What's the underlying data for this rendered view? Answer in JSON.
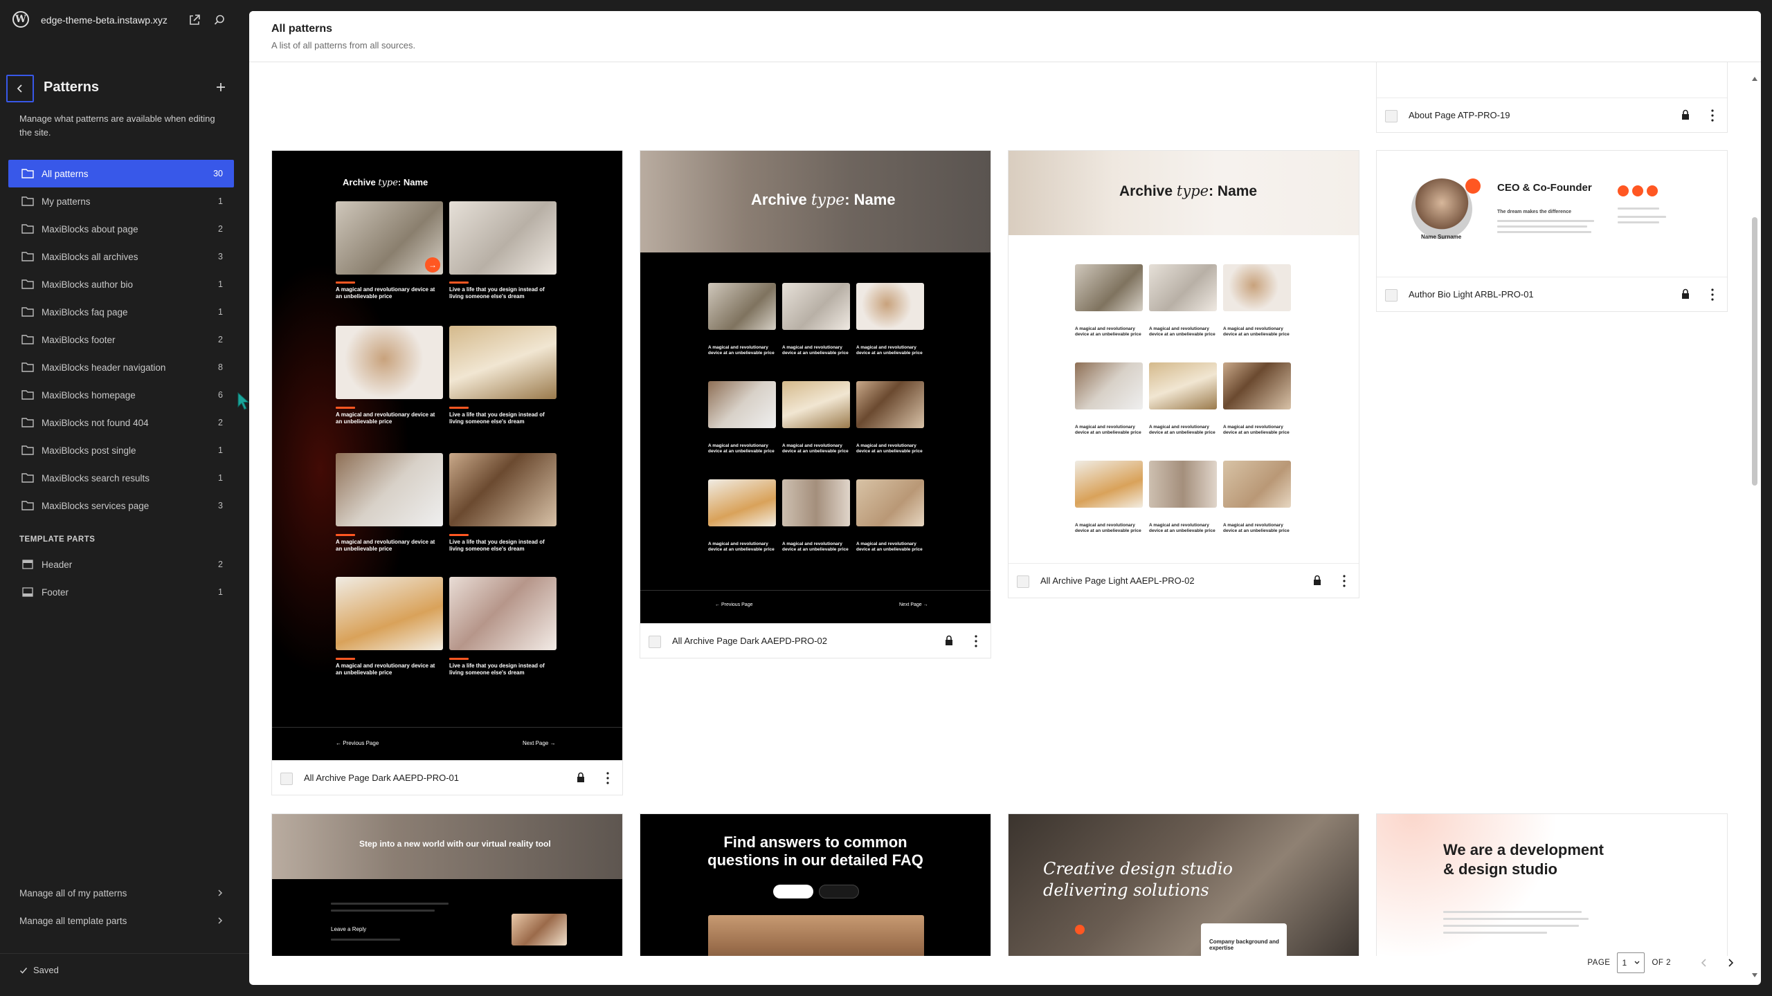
{
  "site": {
    "name": "edge-theme-beta.instawp.xyz"
  },
  "sidebar": {
    "title": "Patterns",
    "description": "Manage what patterns are available when editing the site.",
    "items": [
      {
        "label": "All patterns",
        "count": "30"
      },
      {
        "label": "My patterns",
        "count": "1"
      },
      {
        "label": "MaxiBlocks about page",
        "count": "2"
      },
      {
        "label": "MaxiBlocks all archives",
        "count": "3"
      },
      {
        "label": "MaxiBlocks author bio",
        "count": "1"
      },
      {
        "label": "MaxiBlocks faq page",
        "count": "1"
      },
      {
        "label": "MaxiBlocks footer",
        "count": "2"
      },
      {
        "label": "MaxiBlocks header navigation",
        "count": "8"
      },
      {
        "label": "MaxiBlocks homepage",
        "count": "6"
      },
      {
        "label": "MaxiBlocks not found 404",
        "count": "2"
      },
      {
        "label": "MaxiBlocks post single",
        "count": "1"
      },
      {
        "label": "MaxiBlocks search results",
        "count": "1"
      },
      {
        "label": "MaxiBlocks services page",
        "count": "3"
      }
    ],
    "template_parts_heading": "TEMPLATE PARTS",
    "template_parts": [
      {
        "label": "Header",
        "count": "2"
      },
      {
        "label": "Footer",
        "count": "1"
      }
    ],
    "manage_patterns": "Manage all of my patterns",
    "manage_template_parts": "Manage all template parts",
    "saved": "Saved"
  },
  "main": {
    "title": "All patterns",
    "subtitle": "A list of all patterns from all sources."
  },
  "cards": {
    "c1": {
      "title": "All Archive Page Dark AAEPD-PRO-01"
    },
    "c2": {
      "title": "All Archive Page Dark AAEPD-PRO-02"
    },
    "c3": {
      "title": "All Archive Page Light AAEPL-PRO-02"
    },
    "c4": {
      "title": "About Page ATP-PRO-19"
    },
    "c5": {
      "title": "Author Bio Light ARBL-PRO-01"
    }
  },
  "thumbs": {
    "archive_prefix": "Archive",
    "archive_type": "type",
    "archive_suffix": ": Name",
    "card_head_1": "A magical and revolutionary device at an unbelievable price",
    "card_head_2": "Live a life that you design instead of living someone else's dream",
    "prev_page": "Previous Page",
    "next_page": "Next Page",
    "ceo_title": "CEO & Co-Founder",
    "ceo_sub": "The dream makes the difference",
    "name_surname": "Name Surname",
    "vr_title": "Step into a new world with our virtual reality tool",
    "faq_title_1": "Find answers to common",
    "faq_title_2": "questions in our detailed FAQ",
    "studio_line1": "Creative design studio",
    "studio_line2": "delivering solutions",
    "studio_card": "Company background and expertise",
    "dev_line1": "We are a development",
    "dev_line2": "& design studio",
    "leave_reply": "Leave a Reply"
  },
  "pagination": {
    "page_label": "PAGE",
    "current": "1",
    "of_label": "OF 2"
  },
  "colors": {
    "accent": "#3858e9",
    "sidebar_bg": "#1e1e1e",
    "thumb_orange": "#ff5722"
  }
}
